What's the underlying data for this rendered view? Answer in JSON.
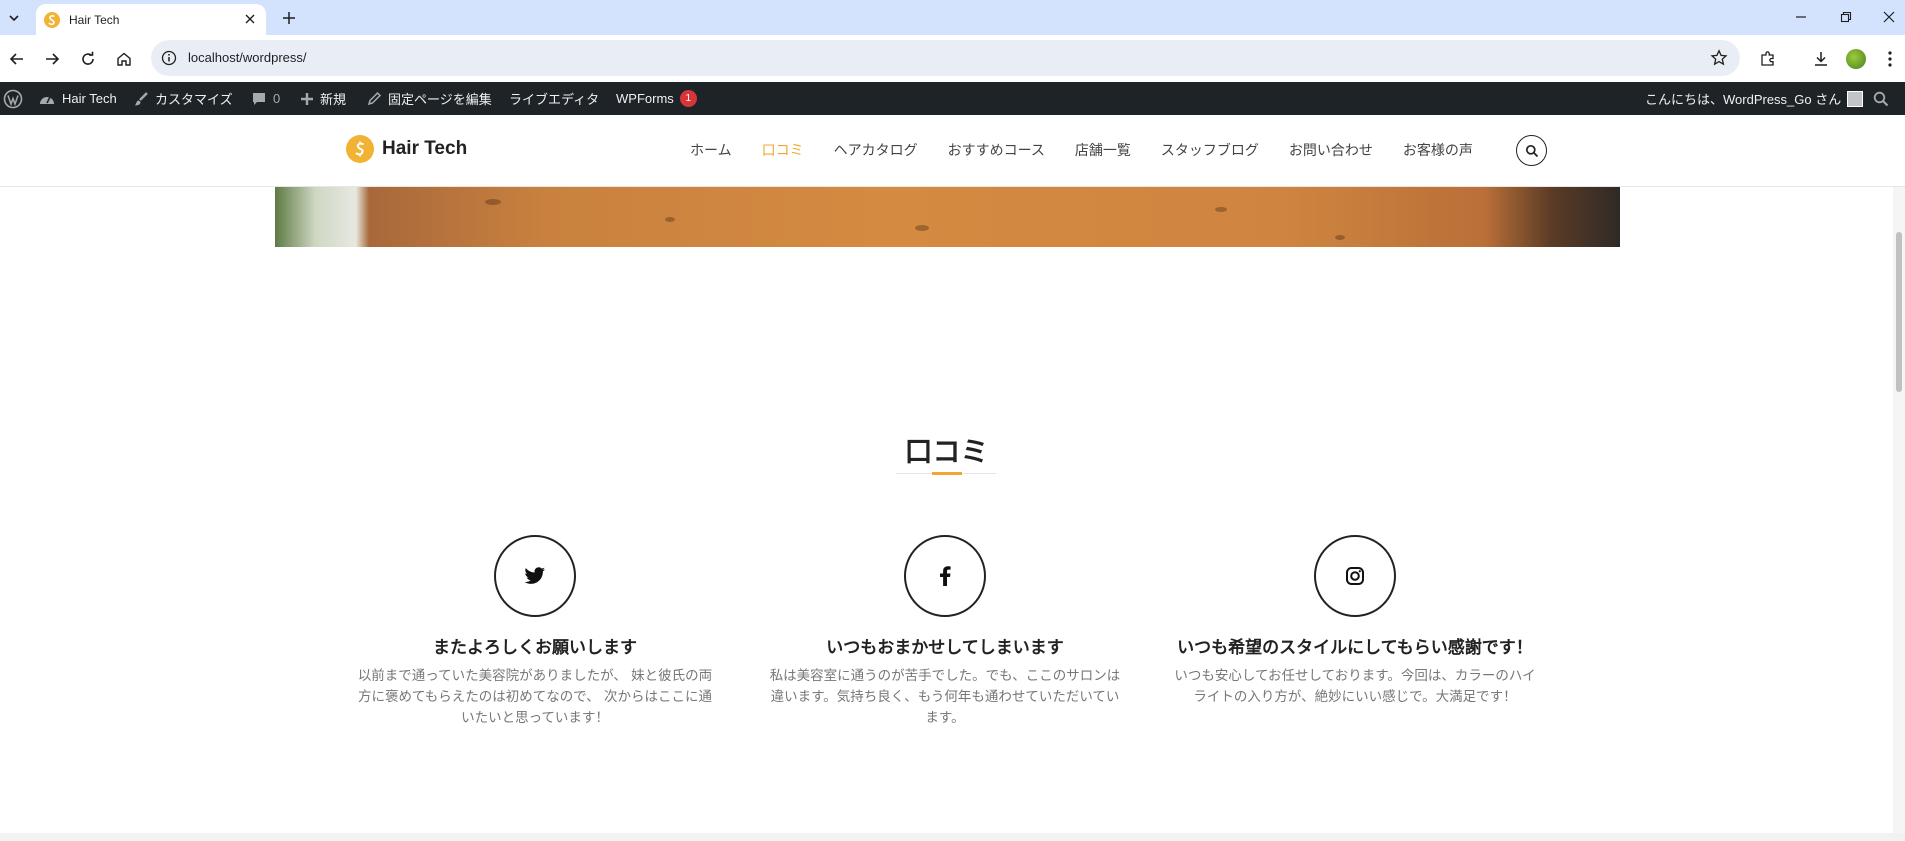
{
  "browser": {
    "tab_title": "Hair Tech",
    "url": "localhost/wordpress/"
  },
  "adminbar": {
    "site_name": "Hair Tech",
    "customize": "カスタマイズ",
    "comments_count": "0",
    "new": "新規",
    "edit_page": "固定ページを編集",
    "live_editor": "ライブエディタ",
    "wpforms": "WPForms",
    "wpforms_badge": "1",
    "greeting": "こんにちは、WordPress_Go さん"
  },
  "header": {
    "logo_text": "Hair Tech",
    "nav": [
      {
        "label": "ホーム"
      },
      {
        "label": "口コミ"
      },
      {
        "label": "ヘアカタログ"
      },
      {
        "label": "おすすめコース"
      },
      {
        "label": "店舗一覧"
      },
      {
        "label": "スタッフブログ"
      },
      {
        "label": "お問い合わせ"
      },
      {
        "label": "お客様の声"
      }
    ],
    "active_nav": "口コミ"
  },
  "section": {
    "title": "口コミ",
    "accent_color": "#f0a832"
  },
  "reviews": [
    {
      "icon": "twitter-icon",
      "title": "またよろしくお願いします",
      "text": "以前まで通っていた美容院がありましたが、 妹と彼氏の両方に褒めてもらえたのは初めてなので、 次からはここに通いたいと思っています！"
    },
    {
      "icon": "facebook-icon",
      "title": "いつもおまかせしてしまいます",
      "text": "私は美容室に通うのが苦手でした。でも、ここのサロンは違います。気持ち良く、もう何年も通わせていただいています。"
    },
    {
      "icon": "instagram-icon",
      "title": "いつも希望のスタイルにしてもらい感謝です！",
      "text": "いつも安心してお任せしております。今回は、カラーのハイライトの入り方が、絶妙にいい感じで。大満足です！"
    }
  ]
}
